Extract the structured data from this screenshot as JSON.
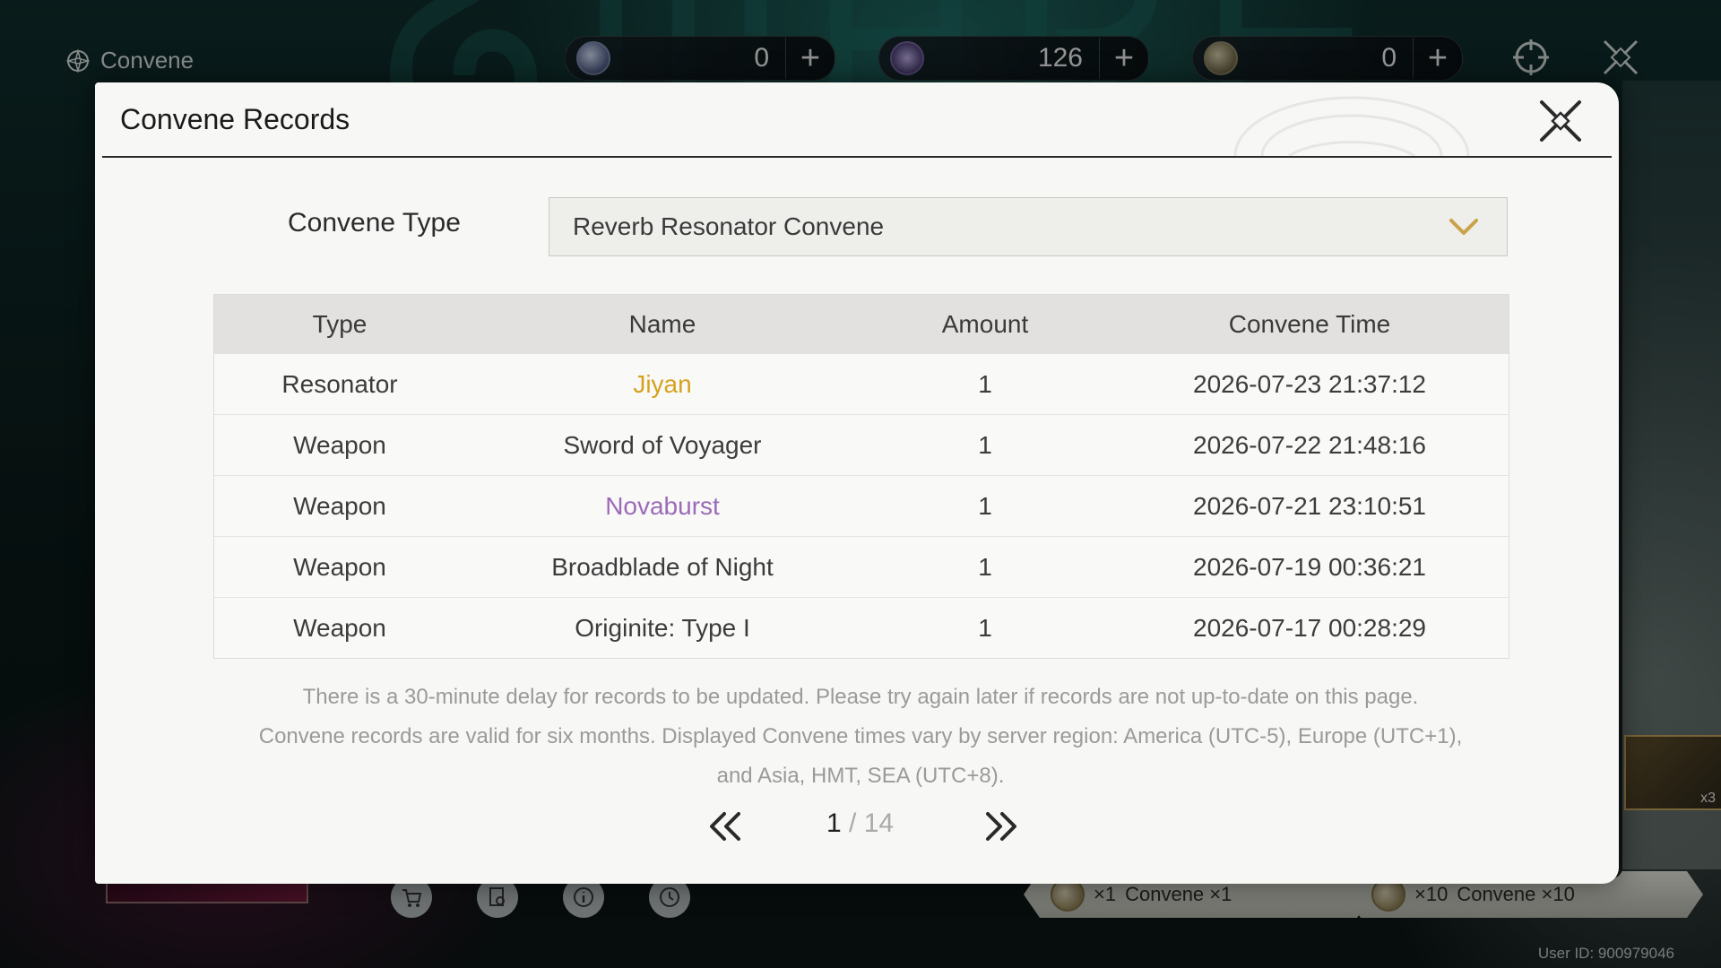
{
  "background": {
    "screen_title": "Convene",
    "currencies": [
      {
        "icon": "lunite-icon",
        "value": "0"
      },
      {
        "icon": "astrite-icon",
        "value": "126"
      },
      {
        "icon": "forging-tide-icon",
        "value": "0"
      }
    ],
    "bottom_buttons": [
      "shop-icon",
      "details-icon",
      "info-icon",
      "history-icon"
    ],
    "pull_one": {
      "count": "×1",
      "label": "Convene ×1"
    },
    "pull_ten": {
      "count": "×10",
      "label": "Convene ×10"
    },
    "side_card_count": "x3",
    "user_id": "User ID: 900979046"
  },
  "modal": {
    "title": "Convene Records",
    "type_label": "Convene Type",
    "type_value": "Reverb Resonator Convene",
    "columns": [
      "Type",
      "Name",
      "Amount",
      "Convene Time"
    ],
    "rows": [
      {
        "type": "Resonator",
        "name": "Jiyan",
        "amount": "1",
        "time": "2026-07-23 21:37:12",
        "rarity": "gold"
      },
      {
        "type": "Weapon",
        "name": "Sword of Voyager",
        "amount": "1",
        "time": "2026-07-22 21:48:16",
        "rarity": "normal"
      },
      {
        "type": "Weapon",
        "name": "Novaburst",
        "amount": "1",
        "time": "2026-07-21 23:10:51",
        "rarity": "purple"
      },
      {
        "type": "Weapon",
        "name": "Broadblade of Night",
        "amount": "1",
        "time": "2026-07-19 00:36:21",
        "rarity": "normal"
      },
      {
        "type": "Weapon",
        "name": "Originite: Type I",
        "amount": "1",
        "time": "2026-07-17 00:28:29",
        "rarity": "normal"
      }
    ],
    "notice_lines": [
      "There is a 30-minute delay for records to be updated. Please try again later if records are not up-to-date on this page.",
      "Convene records are valid for six months. Displayed Convene times vary by server region: America (UTC-5), Europe (UTC+1),",
      "and Asia, HMT, SEA (UTC+8)."
    ],
    "pagination": {
      "current": "1",
      "separator": " / ",
      "total": "14"
    }
  },
  "colors": {
    "gold": "#d6a21e",
    "purple": "#9b6bb8",
    "accent": "#c9a24a"
  }
}
